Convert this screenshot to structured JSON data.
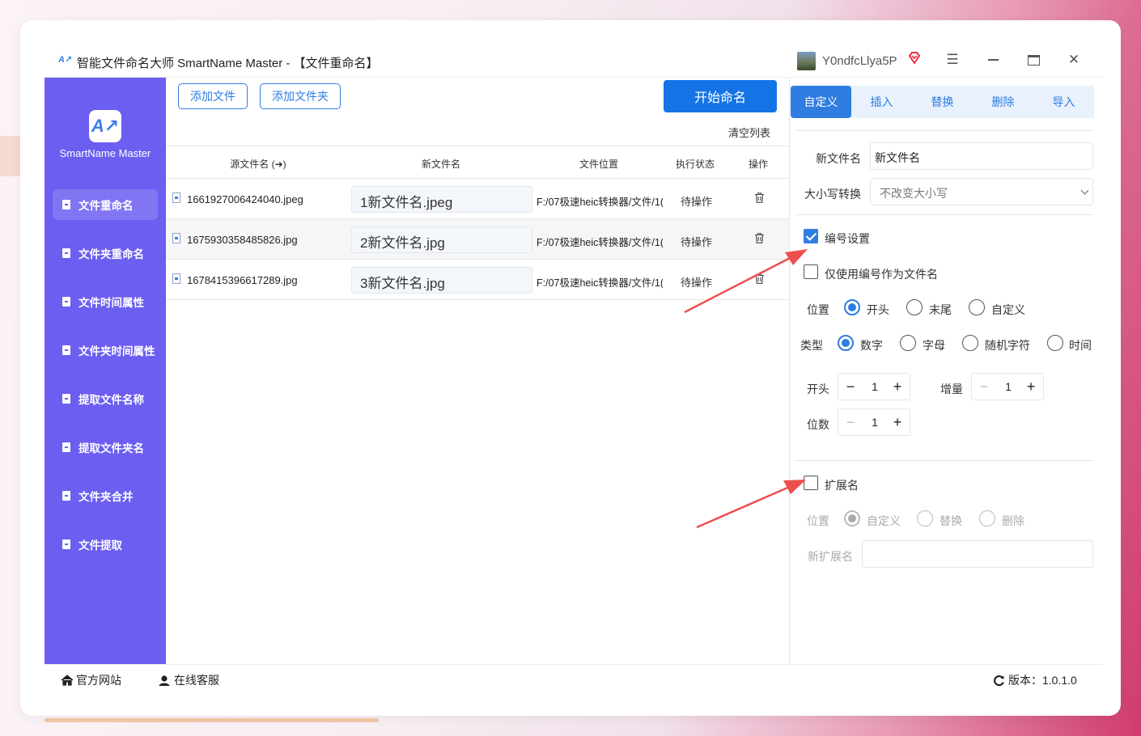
{
  "window": {
    "title": "智能文件命名大师 SmartName Master - 【文件重命名】",
    "username": "Y0ndfcLlya5P"
  },
  "sidebar": {
    "brand": "SmartName Master",
    "items": [
      {
        "label": "文件重命名",
        "active": true
      },
      {
        "label": "文件夹重命名",
        "active": false
      },
      {
        "label": "文件时间属性",
        "active": false
      },
      {
        "label": "文件夹时间属性",
        "active": false
      },
      {
        "label": "提取文件名称",
        "active": false
      },
      {
        "label": "提取文件夹名",
        "active": false
      },
      {
        "label": "文件夹合并",
        "active": false
      },
      {
        "label": "文件提取",
        "active": false
      }
    ]
  },
  "toolbar": {
    "add_file": "添加文件",
    "add_folder": "添加文件夹",
    "start": "开始命名",
    "clear_list": "清空列表"
  },
  "table": {
    "headers": [
      "源文件名 (➜)",
      "新文件名",
      "文件位置",
      "执行状态",
      "操作"
    ],
    "rows": [
      {
        "source": "1661927006424040.jpeg",
        "new_name": "1新文件名.jpeg",
        "location": "F:/07极速heic转换器/文件/1(",
        "status": "待操作"
      },
      {
        "source": "1675930358485826.jpg",
        "new_name": "2新文件名.jpg",
        "location": "F:/07极速heic转换器/文件/1(",
        "status": "待操作"
      },
      {
        "source": "1678415396617289.jpg",
        "new_name": "3新文件名.jpg",
        "location": "F:/07极速heic转换器/文件/1(",
        "status": "待操作"
      }
    ]
  },
  "tabs": [
    {
      "label": "自定义",
      "active": true
    },
    {
      "label": "插入",
      "active": false
    },
    {
      "label": "替换",
      "active": false
    },
    {
      "label": "删除",
      "active": false
    },
    {
      "label": "导入",
      "active": false
    }
  ],
  "settings": {
    "new_filename_label": "新文件名",
    "new_filename_value": "新文件名",
    "case_label": "大小写转换",
    "case_value": "不改变大小写",
    "numbering_label": "编号设置",
    "numbering_checked": true,
    "only_number_label": "仅使用编号作为文件名",
    "only_number_checked": false,
    "position_label": "位置",
    "position_options": [
      "开头",
      "末尾",
      "自定义"
    ],
    "position_selected": "开头",
    "type_label": "类型",
    "type_options": [
      "数字",
      "字母",
      "随机字符",
      "时间"
    ],
    "type_selected": "数字",
    "start_label": "开头",
    "start_value": "1",
    "increment_label": "增量",
    "increment_value": "1",
    "digits_label": "位数",
    "digits_value": "1",
    "ext_label": "扩展名",
    "ext_checked": false,
    "ext_position_label": "位置",
    "ext_position_options": [
      "自定义",
      "替换",
      "删除"
    ],
    "ext_position_selected": "自定义",
    "new_ext_label": "新扩展名",
    "new_ext_value": ""
  },
  "footer": {
    "website": "官方网站",
    "support": "在线客服",
    "version": "版本：1.0.1.0"
  },
  "colors": {
    "sidebar": "#6c5ef1",
    "primary": "#1474e6",
    "accent": "#2f7de1",
    "annotation_arrow": "#ef4e4e"
  }
}
